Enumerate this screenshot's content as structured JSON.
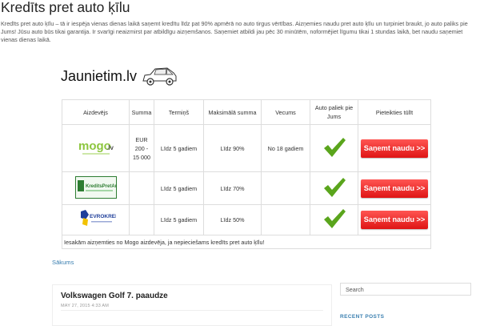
{
  "page": {
    "title": "Kredīts pret auto ķīlu",
    "intro": "Kredīts pret auto ķīlu – tā ir iespēja vienas dienas laikā saņemt kredītu līdz pat 90% apmērā no auto tirgus vērtības. Aizņemies naudu pret auto ķīlu un turpiniet braukt, jo auto paliks pie Jums! Jūsu auto būs tikai garantija. Ir svarīgi neaizmirst par atbildīgu aizņemšanos. Saņemiet atbildi jau pēc 30 minūtēm, noformējiet līgumu tikai 1 stundas laikā, bet naudu saņemiet vienas dienas laikā."
  },
  "banner": {
    "text": "Jaunietim.lv",
    "icon": "car-icon"
  },
  "table": {
    "headers": [
      "Aizdevējs",
      "Summa",
      "Termiņš",
      "Maksimālā summa",
      "Vecums",
      "Auto paliek pie Jums",
      "Pieteikties tūlīt"
    ],
    "rows": [
      {
        "lender_logo": "mogo-logo",
        "logo_text": "mogo.lv",
        "summa": "EUR 200 - 15 000",
        "termins": "Līdz 5 gadiem",
        "max_summa": "Līdz 90%",
        "vecums": "No 18 gadiem",
        "auto_icon": "check-icon",
        "cta": "Saņemt naudu >>"
      },
      {
        "lender_logo": "kreditspretauto-logo",
        "logo_text": "KreditsPretAuto.lv",
        "summa": "",
        "termins": "Līdz 5 gadiem",
        "max_summa": "Līdz 70%",
        "vecums": "",
        "auto_icon": "check-icon",
        "cta": "Saņemt naudu >>"
      },
      {
        "lender_logo": "evrokredit-logo",
        "logo_text": "EVROKREDIT",
        "summa": "",
        "termins": "Līdz 5 gadiem",
        "max_summa": "Līdz 50%",
        "vecums": "",
        "auto_icon": "check-icon",
        "cta": "Saņemt naudu >>"
      }
    ],
    "footer": "Iesakām aizņemties no Mogo aizdevēja, ja nepieciešams kredīts pret auto ķīlu!"
  },
  "breadcrumb": {
    "home": "Sākums"
  },
  "post": {
    "title": "Volkswagen Golf 7. paaudze",
    "date": "May 27, 2015 4:33 am"
  },
  "sidebar": {
    "search_placeholder": "Search",
    "recent_posts": "RECENT POSTS"
  },
  "colors": {
    "accent": "#3a7fb0",
    "cta": "#e52220",
    "check": "#5aa51c",
    "mogo": "#8dc63f"
  }
}
